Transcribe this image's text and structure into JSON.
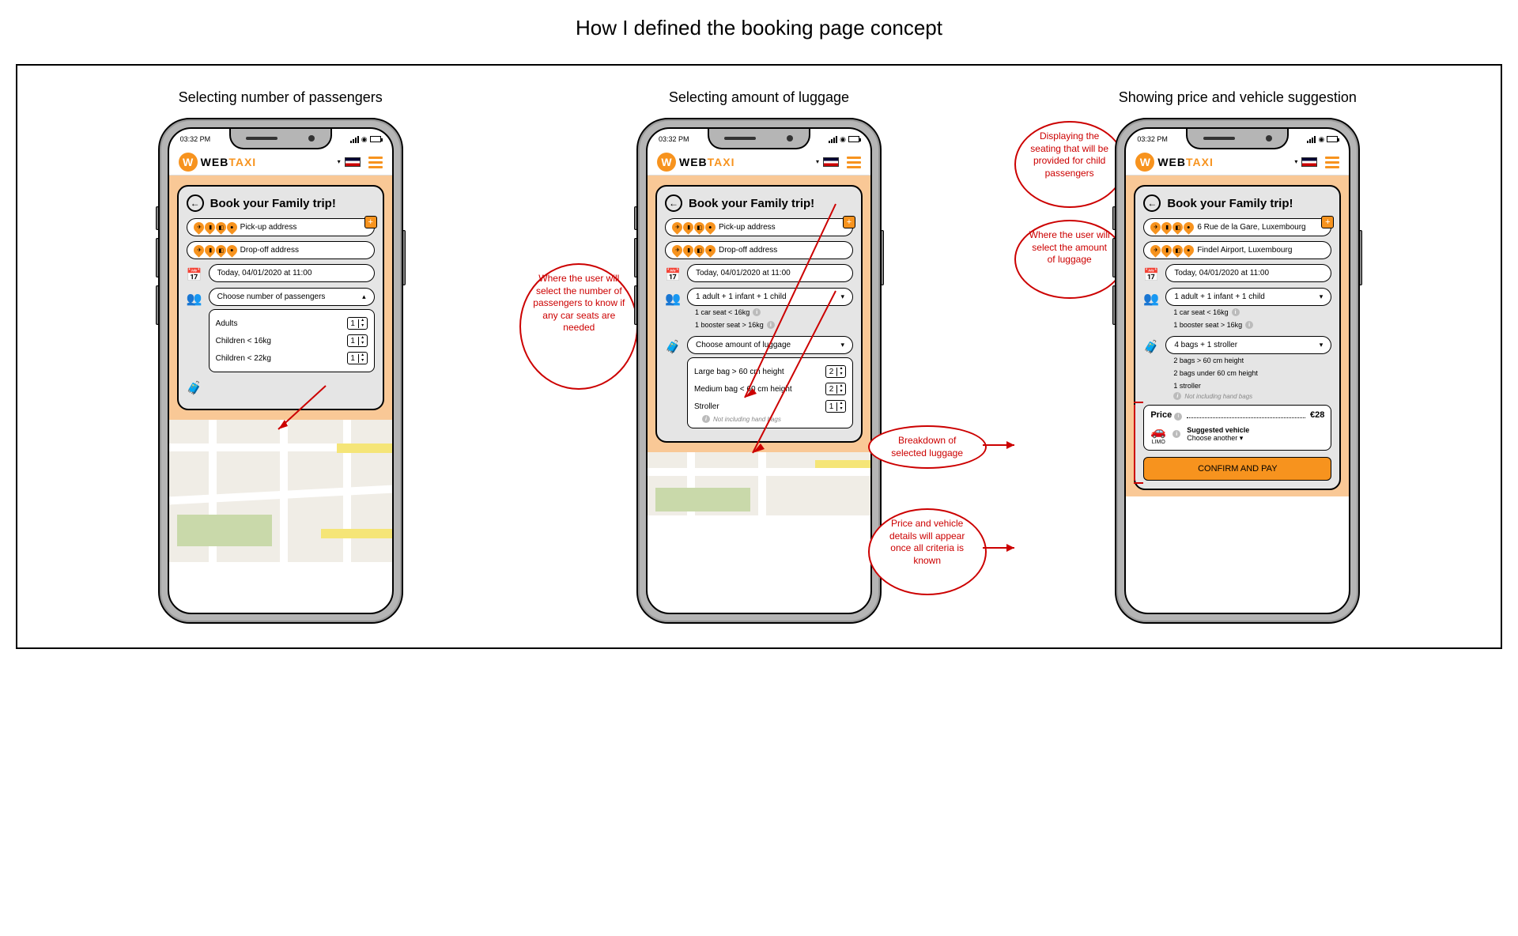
{
  "page_title": "How I defined the booking page concept",
  "columns": [
    {
      "title": "Selecting number of passengers"
    },
    {
      "title": "Selecting amount of luggage"
    },
    {
      "title": "Showing price and vehicle suggestion"
    }
  ],
  "status_time": "03:32 PM",
  "brand": {
    "logo_letter": "W",
    "name_web": "WEB",
    "name_taxi": "TAXI"
  },
  "card_title": "Book your Family trip!",
  "pickup_placeholder": "Pick-up address",
  "dropoff_placeholder": "Drop-off address",
  "pickup_filled": "6 Rue de la Gare, Luxembourg",
  "dropoff_filled": "Findel Airport, Luxembourg",
  "datetime_label": "Today, 04/01/2020 at 11:00",
  "passengers_prompt": "Choose number of passengers",
  "passengers_filled": "1 adult + 1 infant + 1 child",
  "passenger_options": {
    "adults": {
      "label": "Adults",
      "value": "1"
    },
    "child_lt16": {
      "label": "Children < 16kg",
      "value": "1"
    },
    "child_lt22": {
      "label": "Children < 22kg",
      "value": "1"
    }
  },
  "seat_info": {
    "car_seat": "1 car seat < 16kg",
    "booster": "1 booster seat > 16kg"
  },
  "luggage_prompt": "Choose amount of luggage",
  "luggage_filled": "4 bags + 1 stroller",
  "luggage_options": {
    "large": {
      "label": "Large bag > 60 cm height",
      "value": "2"
    },
    "medium": {
      "label": "Medium bag < 60 cm height",
      "value": "2"
    },
    "stroller": {
      "label": "Stroller",
      "value": "1"
    }
  },
  "luggage_note": "Not including hand bags",
  "luggage_breakdown": {
    "line1": "2 bags > 60 cm height",
    "line2": "2 bags under 60 cm height",
    "line3": "1 stroller"
  },
  "price": {
    "label": "Price",
    "value": "€28"
  },
  "vehicle": {
    "type_label": "LIMO",
    "suggested": "Suggested vehicle",
    "choose": "Choose another"
  },
  "confirm_label": "CONFIRM AND PAY",
  "annotations": {
    "a1": "Where the user will select the number of passengers to know if any car seats are needed",
    "a2": "Displaying the seating that will be provided for child passengers",
    "a3": "Where the user will select the amount of luggage",
    "a4": "Breakdown of selected luggage",
    "a5": "Price and vehicle details will appear once all criteria is known"
  }
}
